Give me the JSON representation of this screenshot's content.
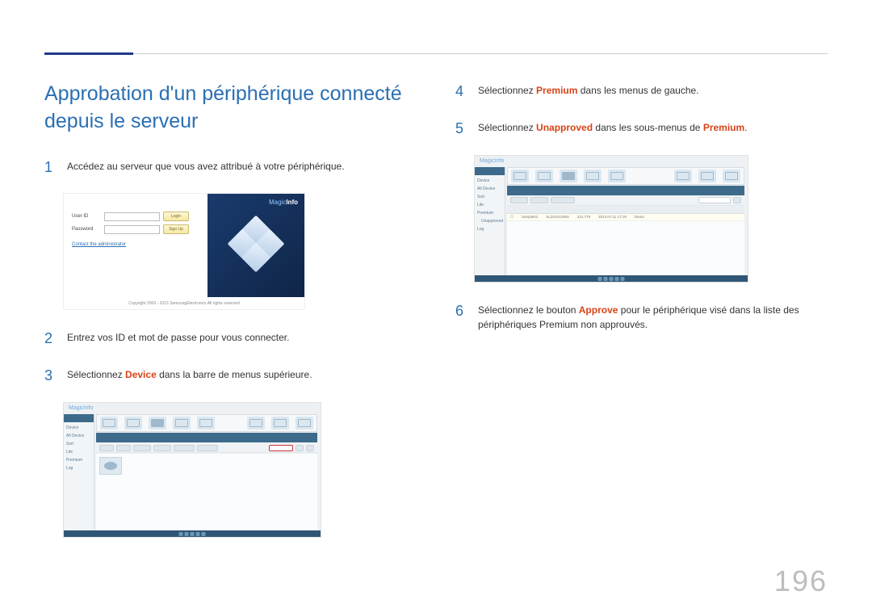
{
  "page_number": "196",
  "title": "Approbation d'un périphérique connecté depuis le serveur",
  "left": {
    "step1": {
      "num": "1",
      "text": "Accédez au serveur que vous avez attribué à votre périphérique."
    },
    "step2": {
      "num": "2",
      "text": "Entrez vos ID et mot de passe pour vous connecter."
    },
    "step3": {
      "num": "3",
      "pre": "Sélectionnez ",
      "hl": "Device",
      "post": " dans la barre de menus supérieure."
    }
  },
  "right": {
    "step4": {
      "num": "4",
      "pre": "Sélectionnez ",
      "hl": "Premium",
      "post": " dans les menus de gauche."
    },
    "step5": {
      "num": "5",
      "pre": "Sélectionnez ",
      "hl": "Unapproved",
      "post": " dans les sous-menus de ",
      "hl2": "Premium",
      "post2": "."
    },
    "step6": {
      "num": "6",
      "pre": "Sélectionnez le bouton ",
      "hl": "Approve",
      "post": " pour le périphérique visé dans la liste des périphériques Premium non approuvés."
    }
  },
  "login": {
    "user_label": "User ID",
    "pass_label": "Password",
    "login_btn": "Login",
    "signup_btn": "Sign Up",
    "contact": "Contact the administrator",
    "copyright": "Copyright 2009 - 2013 SamsungElectronics All rights reserved",
    "brand_a": "Magic",
    "brand_b": "Info"
  },
  "app": {
    "brand_a": "Magic",
    "brand_b": "Info",
    "side": {
      "s0": "Device",
      "s1": "All Device",
      "s2": "Sort",
      "s3": "Lite",
      "s4": "Premium",
      "s5": "Unapproved",
      "s6": "Log"
    }
  }
}
